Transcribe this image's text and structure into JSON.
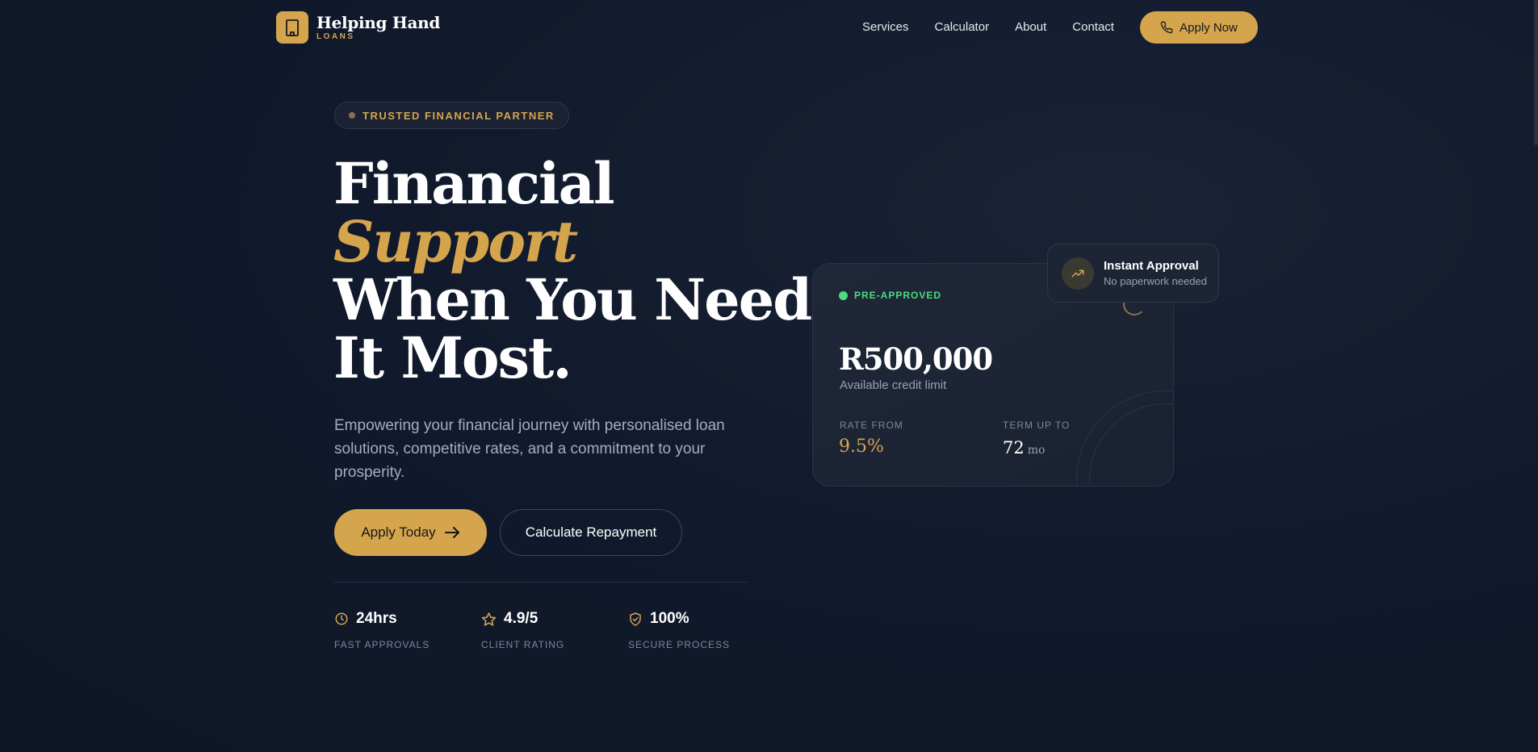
{
  "brand": {
    "name": "Helping Hand",
    "sub": "LOANS",
    "accent": "#d5a54e"
  },
  "nav": {
    "links": [
      "Services",
      "Calculator",
      "About",
      "Contact"
    ],
    "cta": "Apply Now"
  },
  "hero": {
    "badge": "TRUSTED FINANCIAL PARTNER",
    "title_line1": "Financial",
    "title_accent": "Support",
    "title_line3": "When You Need",
    "title_line4": "It Most.",
    "description": "Empowering your financial journey with personalised loan solutions, competitive rates, and a commitment to your prosperity.",
    "primary_button": "Apply Today",
    "secondary_button": "Calculate Repayment"
  },
  "stats": [
    {
      "value": "24hrs",
      "label": "FAST APPROVALS",
      "icon": "clock-icon"
    },
    {
      "value": "4.9/5",
      "label": "CLIENT RATING",
      "icon": "star-icon"
    },
    {
      "value": "100%",
      "label": "SECURE PROCESS",
      "icon": "shield-check-icon"
    }
  ],
  "card": {
    "status": "PRE-APPROVED",
    "status_color": "#4ade80",
    "amount": "R500,000",
    "amount_label": "Available credit limit",
    "rate_label": "RATE FROM",
    "rate_value": "9.5%",
    "term_label": "TERM UP TO",
    "term_value": "72",
    "term_unit": "mo"
  },
  "toast": {
    "title": "Instant Approval",
    "subtitle": "No paperwork needed",
    "icon": "trending-up-icon"
  }
}
